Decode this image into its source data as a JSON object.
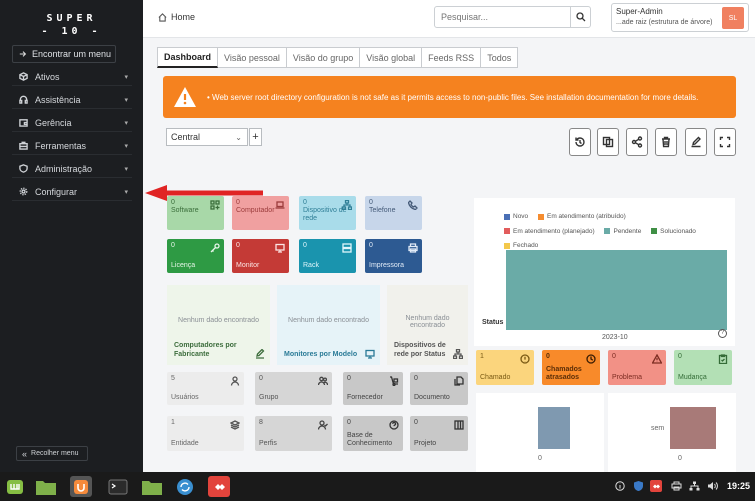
{
  "sidebar": {
    "logo_line1": "SUPER",
    "logo_line2": "- 10 -",
    "find_menu": "Encontrar um menu",
    "items": [
      {
        "label": "Ativos",
        "icon": "box-icon"
      },
      {
        "label": "Assistência",
        "icon": "headset-icon"
      },
      {
        "label": "Gerência",
        "icon": "wallet-icon"
      },
      {
        "label": "Ferramentas",
        "icon": "briefcase-icon"
      },
      {
        "label": "Administração",
        "icon": "shield-icon"
      },
      {
        "label": "Configurar",
        "icon": "gear-icon"
      }
    ],
    "collapse": "Recolher menu"
  },
  "header": {
    "breadcrumb": "Home",
    "search_placeholder": "Pesquisar...",
    "user_name": "Super-Admin",
    "user_entity": "...ade raiz (estrutura de árvore)",
    "avatar_initials": "SL"
  },
  "tabs": [
    "Dashboard",
    "Visão pessoal",
    "Visão do grupo",
    "Visão global",
    "Feeds RSS",
    "Todos"
  ],
  "warning": "Web server root directory configuration is not safe as it permits access to non-public files. See installation documentation for more details.",
  "dashboard_select": "Central",
  "asset_cards": [
    {
      "num": "0",
      "label": "Software",
      "icon": "apps-icon"
    },
    {
      "num": "0",
      "label": "Computador",
      "icon": "laptop-icon"
    },
    {
      "num": "0",
      "label": "Dispositivo de rede",
      "icon": "network-icon"
    },
    {
      "num": "0",
      "label": "Telefone",
      "icon": "phone-icon"
    },
    {
      "num": "0",
      "label": "Licença",
      "icon": "key-icon"
    },
    {
      "num": "0",
      "label": "Monitor",
      "icon": "monitor-icon"
    },
    {
      "num": "0",
      "label": "Rack",
      "icon": "server-icon"
    },
    {
      "num": "0",
      "label": "Impressora",
      "icon": "printer-icon"
    }
  ],
  "empty_panels": [
    {
      "nodata": "Nenhum dado encontrado",
      "title": "Computadores por Fabricante",
      "icon": "edit-chart-icon"
    },
    {
      "nodata": "Nenhum dado encontrado",
      "title": "Monitores por Modelo",
      "icon": "monitor-icon"
    },
    {
      "nodata": "Nenhum dado encontrado",
      "title": "Dispositivos de rede por Status",
      "icon": "network-icon"
    }
  ],
  "grey_cards": [
    {
      "num": "5",
      "label": "Usuários",
      "icon": "user-icon"
    },
    {
      "num": "0",
      "label": "Grupo",
      "icon": "users-icon"
    },
    {
      "num": "0",
      "label": "Fornecedor",
      "icon": "dolly-icon"
    },
    {
      "num": "0",
      "label": "Documento",
      "icon": "files-icon"
    },
    {
      "num": "1",
      "label": "Entidade",
      "icon": "stack-icon"
    },
    {
      "num": "8",
      "label": "Perfis",
      "icon": "user-check-icon"
    },
    {
      "num": "0",
      "label": "Base de Conhecimento",
      "icon": "question-icon"
    },
    {
      "num": "0",
      "label": "Projeto",
      "icon": "columns-icon"
    }
  ],
  "status_chart": {
    "legend": [
      {
        "label": "Novo",
        "color": "#4a6fb5"
      },
      {
        "label": "Em atendimento (atribuído)",
        "color": "#f58c30"
      },
      {
        "label": "Em atendimento (planejado)",
        "color": "#e25c5c"
      },
      {
        "label": "Pendente",
        "color": "#6aaba7"
      },
      {
        "label": "Solucionado",
        "color": "#3f8f45"
      },
      {
        "label": "Fechado",
        "color": "#f3c84b"
      }
    ],
    "ylabel": "Status",
    "help": "?"
  },
  "chart_data": {
    "type": "bar",
    "categories": [
      "2023-10"
    ],
    "series": [
      {
        "name": "Pendente",
        "values": [
          1
        ]
      }
    ]
  },
  "ticket_cards": [
    {
      "num": "1",
      "label": "Chamado",
      "icon": "alert-circle-icon"
    },
    {
      "num": "0",
      "label": "Chamados atrasados",
      "icon": "clock-icon"
    },
    {
      "num": "0",
      "label": "Problema",
      "icon": "warning-icon"
    },
    {
      "num": "0",
      "label": "Mudança",
      "icon": "clipboard-icon"
    }
  ],
  "mini_charts": [
    {
      "zero": "0"
    },
    {
      "label": "sem",
      "zero": "0"
    }
  ],
  "taskbar": {
    "clock": "19:25"
  }
}
